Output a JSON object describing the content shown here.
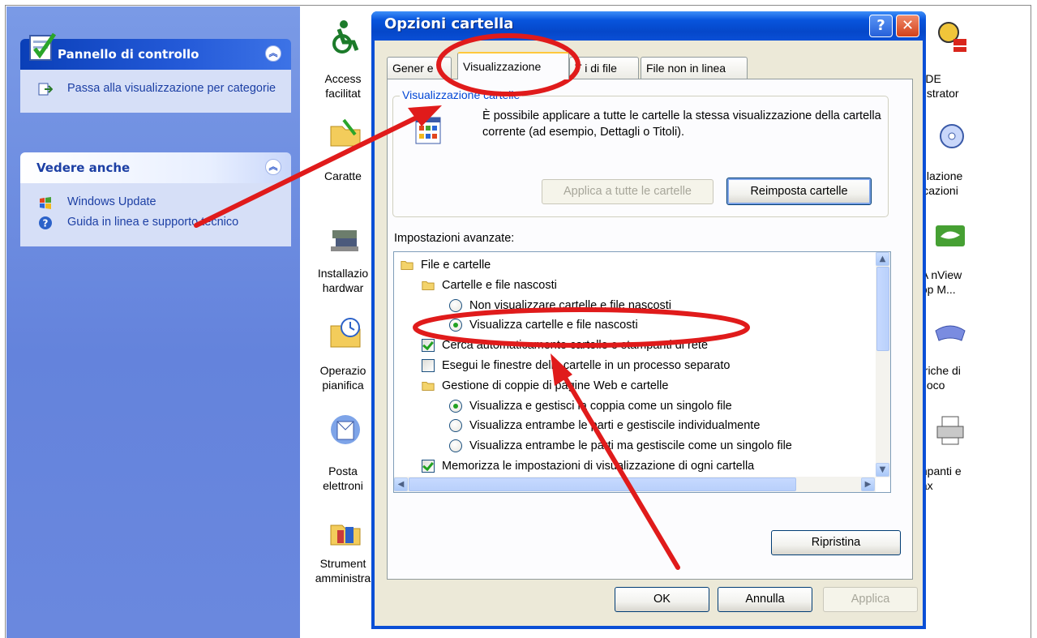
{
  "task_pane": {
    "control_panel": {
      "title": "Pannello di controllo",
      "link": "Passa alla visualizzazione per categorie"
    },
    "see_also": {
      "title": "Vedere anche",
      "links": [
        "Windows Update",
        "Guida in linea e supporto tecnico"
      ]
    }
  },
  "control_panel_icons": {
    "left": [
      "Accesso facilitato",
      "Caratteri",
      "Installazione hardware",
      "Operazioni pianificate",
      "Posta elettronica",
      "Strumenti di amministrazione"
    ],
    "left_visible": [
      "Access\nfacilitat",
      "Caratte",
      "Installazio\nhardwar",
      "Operazio\npianifica",
      "Posta\nelettroni",
      "Strument\namministra"
    ],
    "right_visible": [
      "BDE\nnistrator",
      "allazione\nlicazioni",
      "IA nView\ntop M...",
      "eriche di\ngioco",
      "mpanti e\nfax"
    ]
  },
  "dialog": {
    "title": "Opzioni cartella",
    "tabs": [
      {
        "label": "Generale",
        "visible": "Gener  e"
      },
      {
        "label": "Visualizzazione",
        "active": true
      },
      {
        "label": "Tipi di file",
        "visible": "T   i di file"
      },
      {
        "label": "File non in linea"
      }
    ],
    "folder_views": {
      "group_title": "Visualizzazione cartelle",
      "description": "È possibile applicare a tutte le cartelle la stessa visualizzazione della cartella corrente (ad esempio, Dettagli o Titoli).",
      "apply_all_label": "Applica a tutte le cartelle",
      "reset_label": "Reimposta cartelle"
    },
    "advanced": {
      "label": "Impostazioni avanzate:",
      "items": [
        {
          "kind": "folder",
          "level": 0,
          "text": "File e cartelle"
        },
        {
          "kind": "folder",
          "level": 1,
          "text": "Cartelle e file nascosti"
        },
        {
          "kind": "radio",
          "level": 2,
          "checked": false,
          "text": "Non visualizzare cartelle e file nascosti"
        },
        {
          "kind": "radio",
          "level": 2,
          "checked": true,
          "text": "Visualizza cartelle e file nascosti"
        },
        {
          "kind": "check",
          "level": 1,
          "checked": true,
          "text": "Cerca automaticamente cartelle e stampanti di rete"
        },
        {
          "kind": "check",
          "level": 1,
          "checked": false,
          "text": "Esegui le finestre delle cartelle in un processo separato"
        },
        {
          "kind": "folder",
          "level": 1,
          "text": "Gestione di coppie di pagine Web e cartelle"
        },
        {
          "kind": "radio",
          "level": 2,
          "checked": true,
          "text": "Visualizza e gestisci la coppia come un singolo file"
        },
        {
          "kind": "radio",
          "level": 2,
          "checked": false,
          "text": "Visualizza entrambe le parti e gestiscile individualmente"
        },
        {
          "kind": "radio",
          "level": 2,
          "checked": false,
          "text": "Visualizza entrambe le parti ma gestiscile come un singolo file"
        },
        {
          "kind": "check",
          "level": 1,
          "checked": true,
          "text": "Memorizza le impostazioni di visualizzazione di ogni cartella"
        }
      ]
    },
    "restore_label": "Ripristina",
    "ok_label": "OK",
    "cancel_label": "Annulla",
    "apply_label": "Applica"
  },
  "annotation_colors": {
    "red": "#e01b1b"
  }
}
